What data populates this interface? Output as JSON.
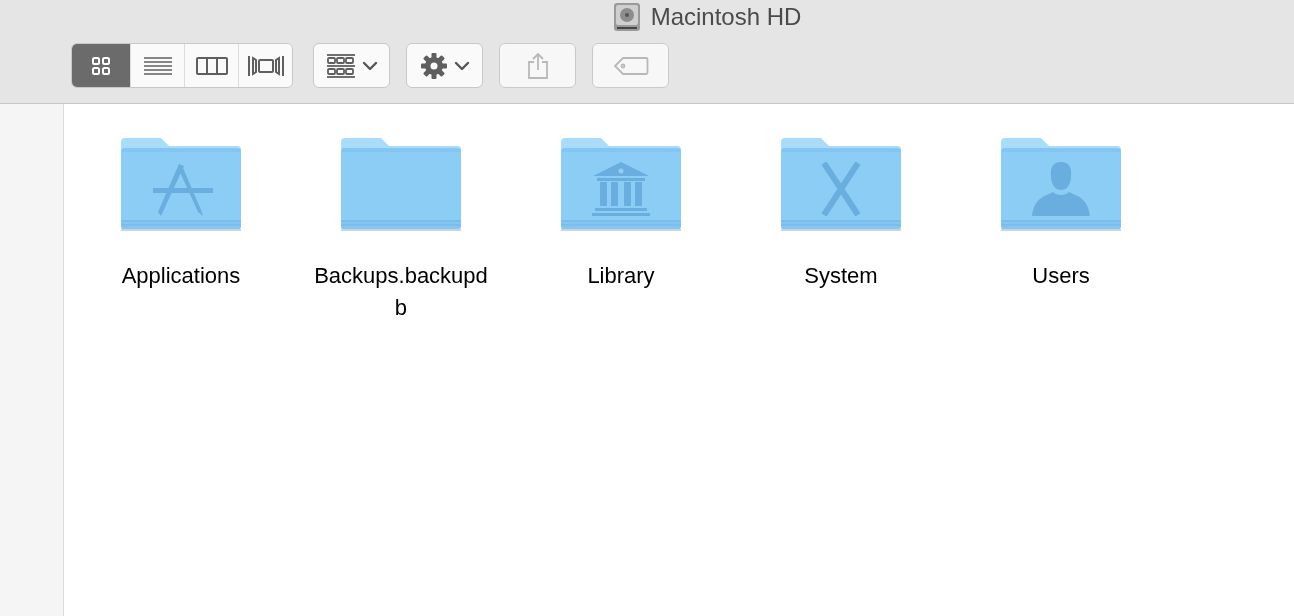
{
  "window": {
    "title": "Macintosh HD"
  },
  "view_modes": [
    {
      "kind": "icons",
      "selected": true
    },
    {
      "kind": "list",
      "selected": false
    },
    {
      "kind": "columns",
      "selected": false
    },
    {
      "kind": "coverflow",
      "selected": false
    }
  ],
  "toolbar": [
    {
      "kind": "arrange",
      "disabled": false
    },
    {
      "kind": "action",
      "disabled": false
    },
    {
      "kind": "share",
      "disabled": true
    },
    {
      "kind": "tags",
      "disabled": true
    }
  ],
  "items": [
    {
      "name": "Applications",
      "kind": "apps"
    },
    {
      "name": "Backups.backupd\nb",
      "kind": "plain"
    },
    {
      "name": "Library",
      "kind": "library"
    },
    {
      "name": "System",
      "kind": "system"
    },
    {
      "name": "Users",
      "kind": "user"
    }
  ]
}
